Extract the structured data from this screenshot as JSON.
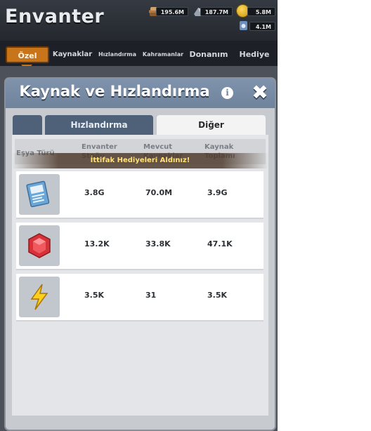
{
  "header": {
    "title": "Envanter",
    "resources": [
      {
        "name": "wood-icon",
        "value": "195.6M"
      },
      {
        "name": "iron-icon",
        "value": "187.7M"
      },
      {
        "name": "gold-icon",
        "value": "5.8M"
      },
      {
        "name": "lab-icon",
        "value": "4.1M"
      }
    ]
  },
  "tabs": [
    {
      "label": "Özel",
      "active": true
    },
    {
      "label": "Kaynaklar"
    },
    {
      "label": "Hızlandırma"
    },
    {
      "label": "Kahramanlar"
    },
    {
      "label": "Donanım"
    },
    {
      "label": "Hediye"
    }
  ],
  "panel": {
    "title": "Kaynak ve Hızlandırma",
    "info_icon": "i",
    "close_icon": "✖",
    "subtabs": [
      {
        "label": "Hızlandırma"
      },
      {
        "label": "Diğer",
        "active": true
      }
    ],
    "columns": [
      "Eşya Türü",
      "Envanter Stoğu",
      "Mevcut Kaynaklar",
      "Kaynak Toplamı"
    ],
    "toast": "İttifak Hediyeleri Aldınız!",
    "rows": [
      {
        "icon": "exp-book-icon",
        "stock": "3.8G",
        "available": "70.0M",
        "total": "3.9G"
      },
      {
        "icon": "ruby-icon",
        "stock": "13.2K",
        "available": "33.8K",
        "total": "47.1K"
      },
      {
        "icon": "energy-bolt-icon",
        "stock": "3.5K",
        "available": "31",
        "total": "3.5K"
      }
    ]
  },
  "colors": {
    "accent_tab": "#c8741a",
    "panel_header": "#7288a2",
    "toast_text": "#ffe07a"
  }
}
